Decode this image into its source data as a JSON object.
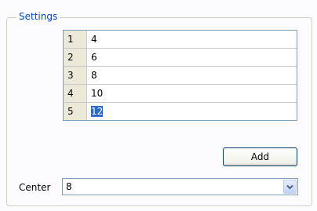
{
  "settings": {
    "legend": "Settings",
    "rows": [
      {
        "index": "1",
        "value": "4"
      },
      {
        "index": "2",
        "value": "6"
      },
      {
        "index": "3",
        "value": "8"
      },
      {
        "index": "4",
        "value": "10"
      },
      {
        "index": "5",
        "value": "12"
      }
    ],
    "add_label": "Add",
    "center_label": "Center",
    "center_value": "8"
  },
  "colors": {
    "legend": "#0046d5",
    "selection": "#316ac5",
    "border": "#7f9db9"
  },
  "icons": {
    "combo_button": "chevron-down-icon"
  }
}
